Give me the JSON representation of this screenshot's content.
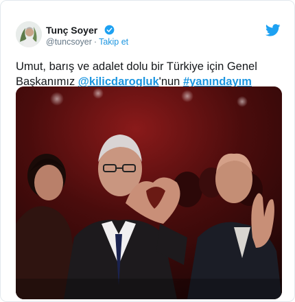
{
  "author": {
    "name": "Tunç Soyer",
    "handle": "@tuncsoyer",
    "separator": "·",
    "follow_label": "Takip et"
  },
  "tweet": {
    "text_before": "Umut, barış ve adalet dolu bir Türkiye için Genel Başkanımız ",
    "mention": "@kilicdarogluk",
    "text_middle": "'nun ",
    "hashtag": "#yanındayım"
  },
  "icons": {
    "verified": "verified-badge-icon",
    "brand": "twitter-bird-icon"
  },
  "colors": {
    "accent": "#1b95e0",
    "verified": "#1da1f2",
    "text": "#14171a",
    "muted": "#657786",
    "photo_bg": "#2a0a0a"
  }
}
